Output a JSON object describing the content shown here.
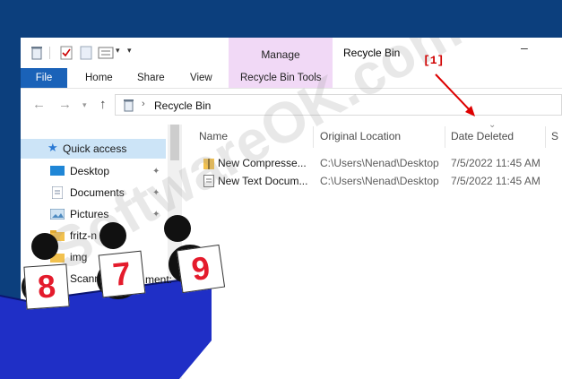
{
  "window": {
    "title": "Recycle Bin",
    "minimize_glyph": "–"
  },
  "ribbon": {
    "context_group": "Manage",
    "tabs": [
      "File",
      "Home",
      "Share",
      "View",
      "Recycle Bin Tools"
    ]
  },
  "address": {
    "path": "Recycle Bin",
    "separator": "›",
    "back_glyph": "←",
    "forward_glyph": "→",
    "up_glyph": "↑"
  },
  "nav_pane": {
    "quick_access": "Quick access",
    "items": [
      {
        "label": "Desktop",
        "icon": "desktop-icon",
        "pinned": true
      },
      {
        "label": "Documents",
        "icon": "documents-icon",
        "pinned": true
      },
      {
        "label": "Pictures",
        "icon": "pictures-icon",
        "pinned": true
      },
      {
        "label": "fritz-n",
        "icon": "folder-icon",
        "pinned": false
      },
      {
        "label": "img",
        "icon": "folder-icon",
        "pinned": false
      },
      {
        "label": "Scann",
        "icon": "folder-icon",
        "pinned": false
      }
    ],
    "pin_glyph": "📌"
  },
  "columns": [
    "Name",
    "Original Location",
    "Date Deleted",
    "S"
  ],
  "files": [
    {
      "name": "New Compresse...",
      "location": "C:\\Users\\Nenad\\Desktop",
      "date": "7/5/2022 11:45 AM",
      "icon": "zip-folder-icon"
    },
    {
      "name": "New Text Docum...",
      "location": "C:\\Users\\Nenad\\Desktop",
      "date": "7/5/2022 11:45 AM",
      "icon": "text-file-icon"
    }
  ],
  "annotation": {
    "label": "[1]",
    "color": "#dd0000"
  },
  "watermark": "SoftwareOK.com",
  "cards": [
    "8",
    "7",
    "9"
  ],
  "card_partial": "ment:",
  "colors": {
    "background": "#0c3f7d",
    "file_tab": "#1a62b8",
    "context_tab": "#f1d9f6",
    "selected": "#cce4f7",
    "stand": "#1f2fc6"
  }
}
